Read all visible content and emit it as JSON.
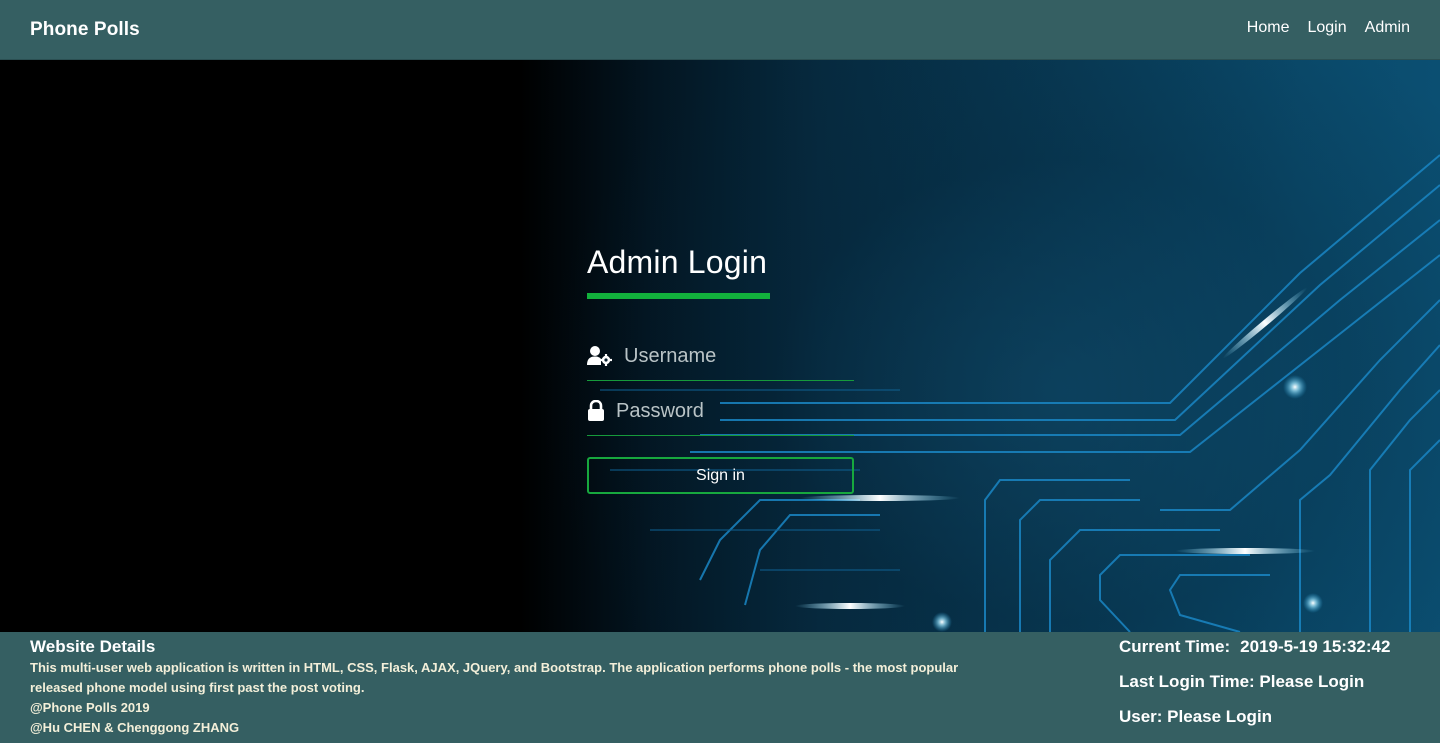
{
  "header": {
    "brand": "Phone Polls",
    "nav": {
      "home": "Home",
      "login": "Login",
      "admin": "Admin"
    }
  },
  "login": {
    "title": "Admin Login",
    "username_placeholder": "Username",
    "password_placeholder": "Password",
    "signin_label": "Sign in",
    "icons": {
      "username": "user-gear-icon",
      "password": "lock-icon"
    }
  },
  "footer": {
    "heading": "Website Details",
    "description": "This multi-user web application is written in HTML, CSS, Flask, AJAX, JQuery, and Bootstrap. The application performs phone polls - the most popular released phone model using first past the post voting.",
    "copyright": "@Phone Polls 2019",
    "authors": "@Hu CHEN & Chenggong ZHANG",
    "current_time_label": "Current Time:",
    "current_time_value": "2019-5-19 15:32:42",
    "last_login": "Last Login Time: Please Login",
    "user": "User: Please Login"
  },
  "colors": {
    "header_bg": "#355f62",
    "accent_green": "#12b13c",
    "footer_text": "#f3efd9"
  }
}
